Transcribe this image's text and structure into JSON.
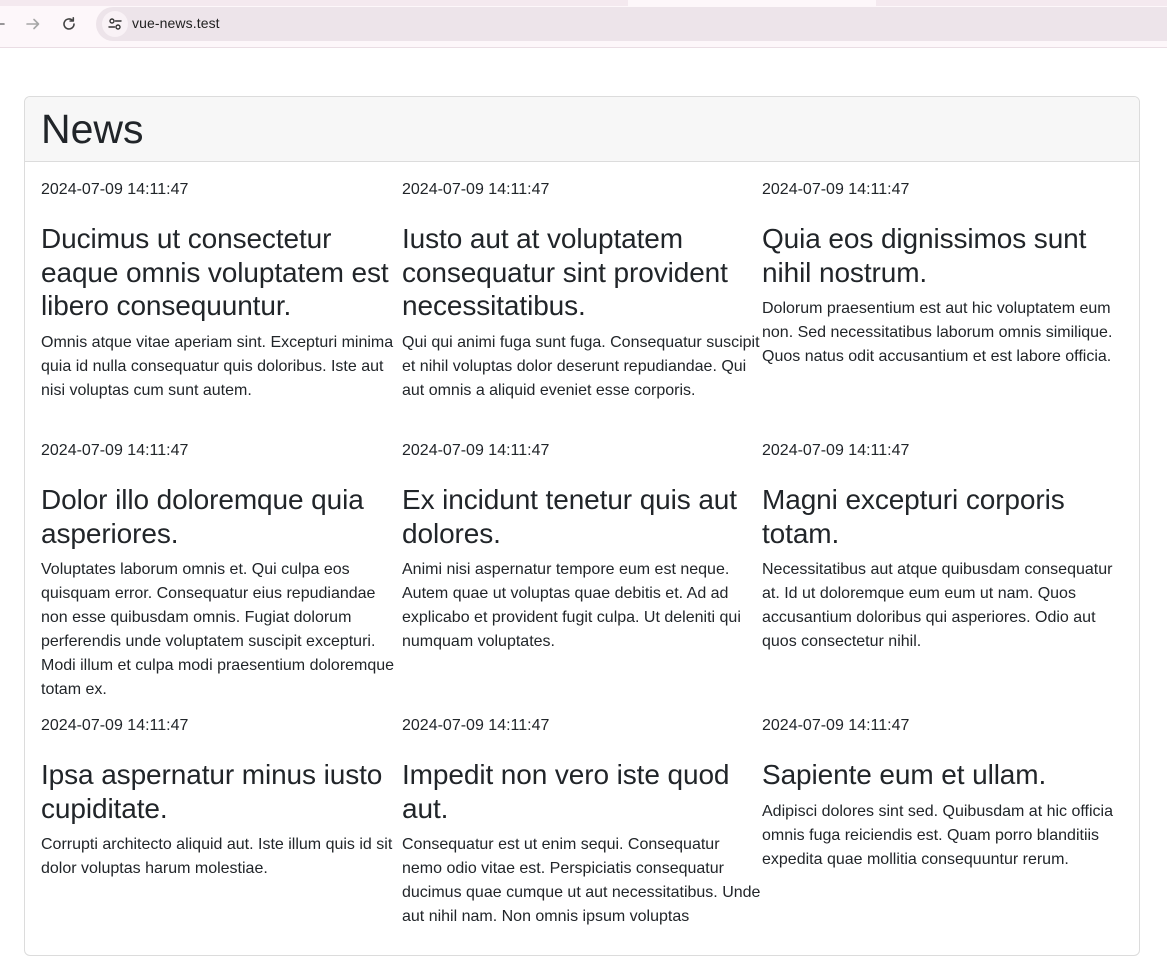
{
  "browser": {
    "url": "vue-news.test"
  },
  "page": {
    "heading": "News"
  },
  "news": [
    {
      "date": "2024-07-09 14:11:47",
      "title": "Ducimus ut consectetur eaque omnis voluptatem est libero consequuntur.",
      "body": "Omnis atque vitae aperiam sint. Excepturi minima quia id nulla consequatur quis doloribus. Iste aut nisi voluptas cum sunt autem."
    },
    {
      "date": "2024-07-09 14:11:47",
      "title": "Iusto aut at voluptatem consequatur sint provident necessitatibus.",
      "body": "Qui qui animi fuga sunt fuga. Consequatur suscipit et nihil voluptas dolor deserunt repudiandae. Qui aut omnis a aliquid eveniet esse corporis."
    },
    {
      "date": "2024-07-09 14:11:47",
      "title": "Quia eos dignissimos sunt nihil nostrum.",
      "body": "Dolorum praesentium est aut hic voluptatem eum non. Sed necessitatibus laborum omnis similique. Quos natus odit accusantium et est labore officia."
    },
    {
      "date": "2024-07-09 14:11:47",
      "title": "Dolor illo doloremque quia asperiores.",
      "body": "Voluptates laborum omnis et. Qui culpa eos quisquam error. Consequatur eius repudiandae non esse quibusdam omnis. Fugiat dolorum perferendis unde voluptatem suscipit excepturi. Modi illum et culpa modi praesentium doloremque totam ex."
    },
    {
      "date": "2024-07-09 14:11:47",
      "title": "Ex incidunt tenetur quis aut dolores.",
      "body": "Animi nisi aspernatur tempore eum est neque. Autem quae ut voluptas quae debitis et. Ad ad explicabo et provident fugit culpa. Ut deleniti qui numquam voluptates."
    },
    {
      "date": "2024-07-09 14:11:47",
      "title": "Magni excepturi corporis totam.",
      "body": "Necessitatibus aut atque quibusdam consequatur at. Id ut doloremque eum eum ut nam. Quos accusantium doloribus qui asperiores. Odio aut quos consectetur nihil."
    },
    {
      "date": "2024-07-09 14:11:47",
      "title": "Ipsa aspernatur minus iusto cupiditate.",
      "body": "Corrupti architecto aliquid aut. Iste illum quis id sit dolor voluptas harum molestiae."
    },
    {
      "date": "2024-07-09 14:11:47",
      "title": "Impedit non vero iste quod aut.",
      "body": "Consequatur est ut enim sequi. Consequatur nemo odio vitae est. Perspiciatis consequatur ducimus quae cumque ut aut necessitatibus. Unde aut nihil nam. Non omnis ipsum voluptas"
    },
    {
      "date": "2024-07-09 14:11:47",
      "title": "Sapiente eum et ullam.",
      "body": "Adipisci dolores sint sed. Quibusdam at hic officia omnis fuga reiciendis est. Quam porro blanditiis expedita quae mollitia consequuntur rerum."
    }
  ]
}
